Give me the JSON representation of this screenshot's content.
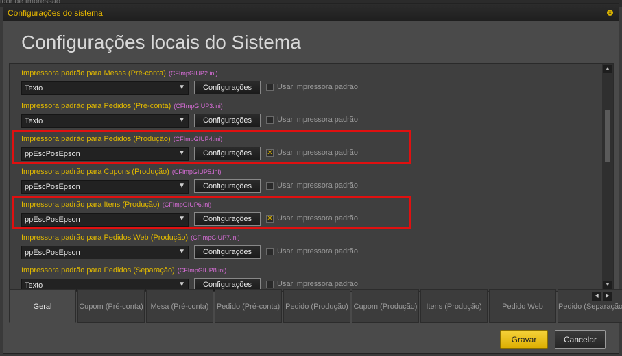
{
  "background": {
    "partial_text": "idor de Impressão"
  },
  "window": {
    "title": "Configurações do sistema",
    "close_glyph": "×"
  },
  "page_title": "Configurações locais do Sistema",
  "colors": {
    "accent": "#e0b800",
    "file_hint": "#d96ed9",
    "highlight": "#e01010",
    "save_button": "#f2c811"
  },
  "rows": [
    {
      "label": "Impressora padrão para Mesas (Pré-conta)",
      "file": "(CFImpGIUP2.ini)",
      "value": "Texto",
      "config_label": "Configurações",
      "checkbox_label": "Usar impressora padrão",
      "checked": false,
      "highlighted": false
    },
    {
      "label": "Impressora padrão para Pedidos (Pré-conta)",
      "file": "(CFImpGIUP3.ini)",
      "value": "Texto",
      "config_label": "Configurações",
      "checkbox_label": "Usar impressora padrão",
      "checked": false,
      "highlighted": false
    },
    {
      "label": "Impressora padrão para Pedidos (Produção)",
      "file": "(CFImpGIUP4.ini)",
      "value": "ppEscPosEpson",
      "config_label": "Configurações",
      "checkbox_label": "Usar impressora padrão",
      "checked": true,
      "highlighted": true
    },
    {
      "label": "Impressora padrão para Cupons (Produção)",
      "file": "(CFImpGIUP5.ini)",
      "value": "ppEscPosEpson",
      "config_label": "Configurações",
      "checkbox_label": "Usar impressora padrão",
      "checked": false,
      "highlighted": false
    },
    {
      "label": "Impressora padrão para Itens (Produção)",
      "file": "(CFImpGIUP6.ini)",
      "value": "ppEscPosEpson",
      "config_label": "Configurações",
      "checkbox_label": "Usar impressora padrão",
      "checked": true,
      "highlighted": true
    },
    {
      "label": "Impressora padrão para Pedidos Web (Produção)",
      "file": "(CFImpGIUP7.ini)",
      "value": "ppEscPosEpson",
      "config_label": "Configurações",
      "checkbox_label": "Usar impressora padrão",
      "checked": false,
      "highlighted": false
    },
    {
      "label": "Impressora padrão para Pedidos (Separação)",
      "file": "(CFImpGIUP8.ini)",
      "value": "Texto",
      "config_label": "Configurações",
      "checkbox_label": "Usar impressora padrão",
      "checked": false,
      "highlighted": false
    }
  ],
  "tabs": [
    {
      "label": "Geral",
      "active": true
    },
    {
      "label": "Cupom (Pré-conta)",
      "active": false
    },
    {
      "label": "Mesa (Pré-conta)",
      "active": false
    },
    {
      "label": "Pedido (Pré-conta)",
      "active": false
    },
    {
      "label": "Pedido (Produção)",
      "active": false
    },
    {
      "label": "Cupom (Produção)",
      "active": false
    },
    {
      "label": "Itens (Produção)",
      "active": false
    },
    {
      "label": "Pedido Web",
      "active": false
    },
    {
      "label": "Pedido (Separação)",
      "active": false
    }
  ],
  "footer": {
    "save_label": "Gravar",
    "cancel_label": "Cancelar"
  },
  "icons": {
    "dropdown": "chevron-down-icon",
    "check": "check-icon",
    "scroll_up": "arrow-up-icon",
    "scroll_down": "arrow-down-icon",
    "tab_left": "arrow-left-icon",
    "tab_right": "arrow-right-icon"
  }
}
